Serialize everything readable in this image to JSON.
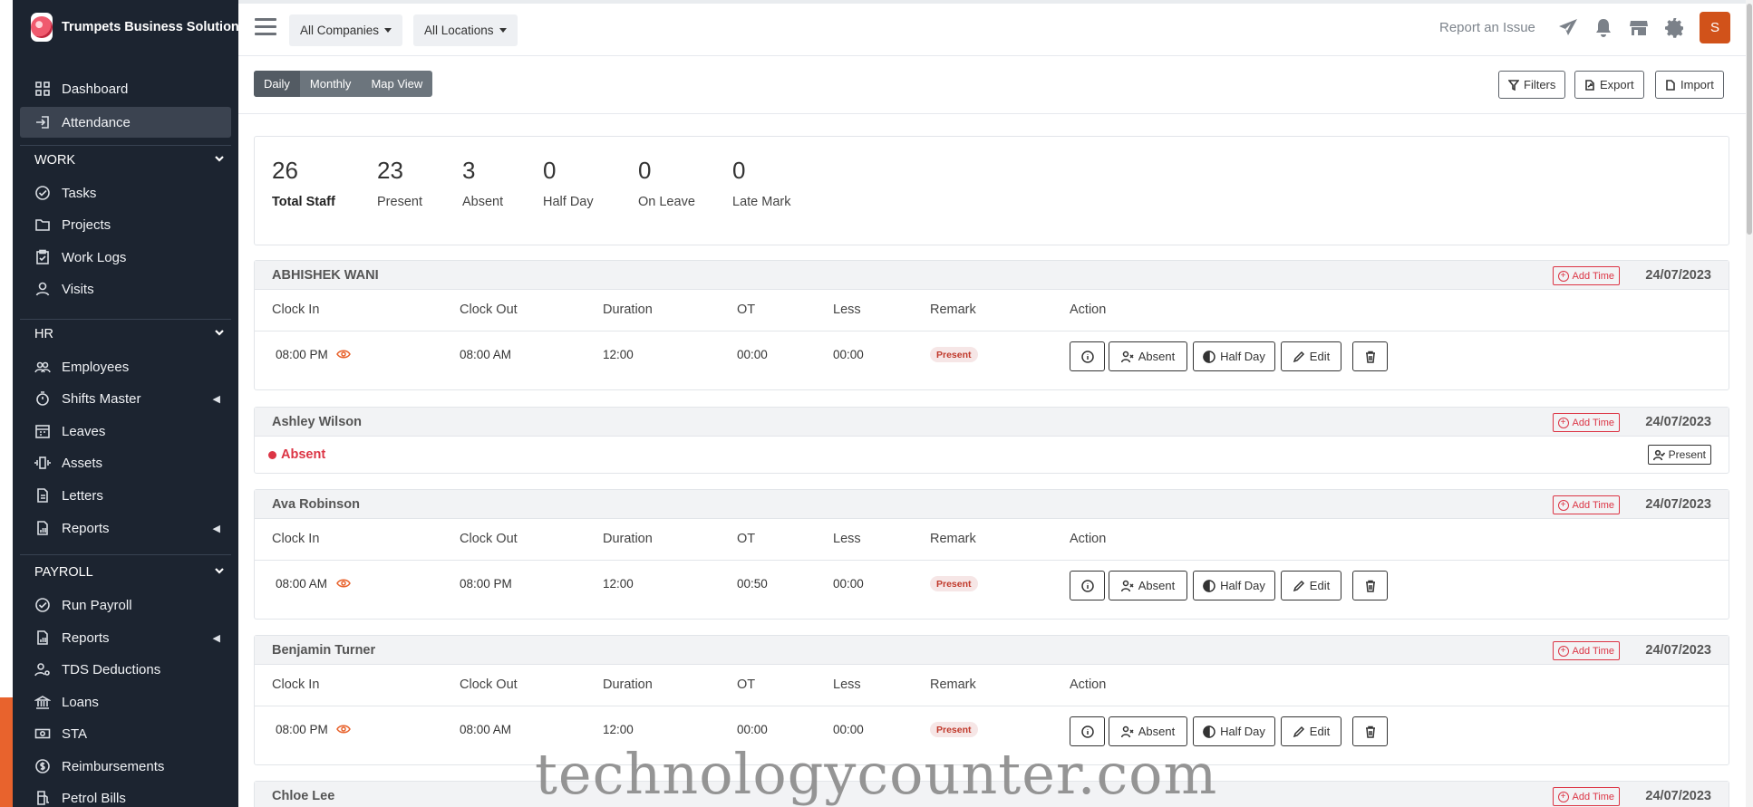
{
  "brand": {
    "name": "Trumpets Business Solutions"
  },
  "sidebar": {
    "top_items": [
      {
        "label": "Dashboard",
        "icon": "grid-icon"
      },
      {
        "label": "Attendance",
        "icon": "sign-in-icon"
      }
    ],
    "sections": [
      {
        "title": "WORK",
        "items": [
          {
            "label": "Tasks",
            "icon": "check-circle-icon"
          },
          {
            "label": "Projects",
            "icon": "folder-icon"
          },
          {
            "label": "Work Logs",
            "icon": "clipboard-icon"
          },
          {
            "label": "Visits",
            "icon": "person-icon"
          }
        ]
      },
      {
        "title": "HR",
        "items": [
          {
            "label": "Employees",
            "icon": "people-icon"
          },
          {
            "label": "Shifts Master",
            "icon": "stopwatch-icon"
          },
          {
            "label": "Leaves",
            "icon": "calendar-icon"
          },
          {
            "label": "Assets",
            "icon": "vibrate-icon"
          },
          {
            "label": "Letters",
            "icon": "document-icon"
          },
          {
            "label": "Reports",
            "icon": "report-icon"
          }
        ]
      },
      {
        "title": "PAYROLL",
        "items": [
          {
            "label": "Run Payroll",
            "icon": "check-circle-icon"
          },
          {
            "label": "Reports",
            "icon": "report-icon"
          },
          {
            "label": "TDS Deductions",
            "icon": "person-gear-icon"
          },
          {
            "label": "Loans",
            "icon": "bank-icon"
          },
          {
            "label": "STA",
            "icon": "cash-icon"
          },
          {
            "label": "Reimbursements",
            "icon": "dollar-circle-icon"
          },
          {
            "label": "Petrol Bills",
            "icon": "fuel-icon"
          }
        ]
      }
    ]
  },
  "topbar": {
    "company_filter": "All Companies",
    "location_filter": "All Locations",
    "report_issue": "Report an Issue",
    "avatar_initial": "S"
  },
  "view_tabs": [
    "Daily",
    "Monthly",
    "Map View"
  ],
  "toolbar": {
    "filters": "Filters",
    "export": "Export",
    "import": "Import"
  },
  "stats": [
    {
      "value": "26",
      "label": "Total Staff"
    },
    {
      "value": "23",
      "label": "Present"
    },
    {
      "value": "3",
      "label": "Absent"
    },
    {
      "value": "0",
      "label": "Half Day"
    },
    {
      "value": "0",
      "label": "On Leave"
    },
    {
      "value": "0",
      "label": "Late Mark"
    }
  ],
  "table_headers": {
    "clock_in": "Clock In",
    "clock_out": "Clock Out",
    "duration": "Duration",
    "ot": "OT",
    "less": "Less",
    "remark": "Remark",
    "action": "Action"
  },
  "actions": {
    "add_time": "Add Time",
    "absent": "Absent",
    "half_day": "Half Day",
    "edit": "Edit",
    "present": "Present"
  },
  "records": [
    {
      "name": "ABHISHEK WANI",
      "date": "24/07/2023",
      "clock_in": "08:00 PM",
      "clock_out": "08:00 AM",
      "duration": "12:00",
      "ot": "00:00",
      "less": "00:00",
      "remark": "Present"
    },
    {
      "name": "Ashley Wilson",
      "date": "24/07/2023",
      "status": "Absent"
    },
    {
      "name": "Ava Robinson",
      "date": "24/07/2023",
      "clock_in": "08:00 AM",
      "clock_out": "08:00 PM",
      "duration": "12:00",
      "ot": "00:50",
      "less": "00:00",
      "remark": "Present"
    },
    {
      "name": "Benjamin Turner",
      "date": "24/07/2023",
      "clock_in": "08:00 PM",
      "clock_out": "08:00 AM",
      "duration": "12:00",
      "ot": "00:00",
      "less": "00:00",
      "remark": "Present"
    },
    {
      "name": "Chloe Lee",
      "date": "24/07/2023"
    }
  ],
  "watermark": "technologycounter.com",
  "colors": {
    "sidebar_bg": "#1c2430",
    "accent_orange": "#e8632d",
    "danger": "#dc3545",
    "avatar": "#d1521a"
  }
}
